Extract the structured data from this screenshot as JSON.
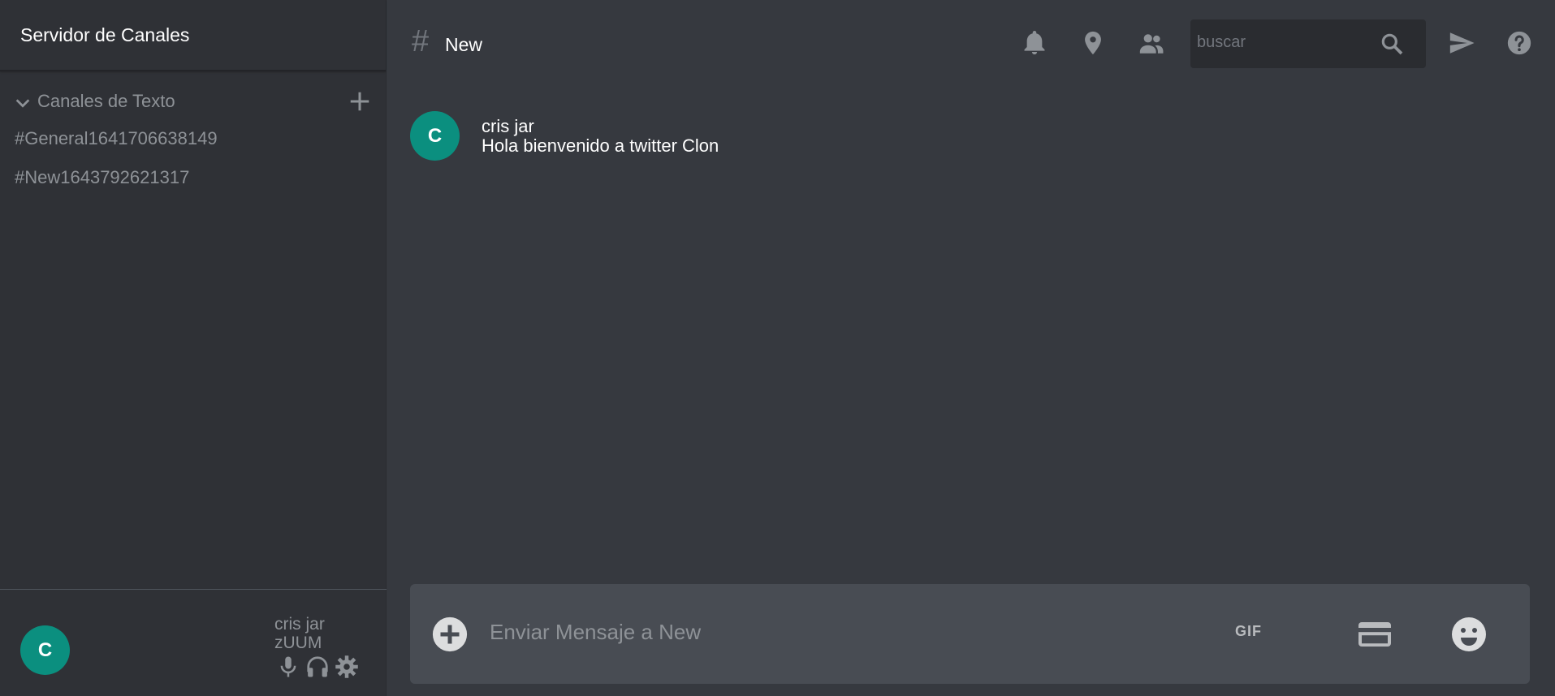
{
  "sidebar": {
    "server_title": "Servidor de Canales",
    "section_label": "Canales de Texto",
    "channels": [
      {
        "label": "#General1641706638149"
      },
      {
        "label": "#New1643792621317"
      }
    ],
    "user": {
      "avatar_letter": "C",
      "name": "cris jar",
      "tag": "zUUM"
    }
  },
  "header": {
    "hash_symbol": "#",
    "channel_name": "New",
    "search": {
      "placeholder": "buscar"
    }
  },
  "messages": [
    {
      "avatar_letter": "C",
      "author": "cris jar",
      "text": "Hola bienvenido a twitter Clon"
    }
  ],
  "composer": {
    "placeholder": "Enviar Mensaje a New",
    "gif_label": "GIF"
  },
  "colors": {
    "sidebar_bg": "#2f3136",
    "main_bg": "#36393f",
    "avatar_bg": "#0b8f7f",
    "icon_gray": "#8e9297",
    "composer_bg": "#484c53"
  },
  "icons": [
    "chevron-down-icon",
    "plus-icon",
    "mic-icon",
    "headphones-icon",
    "gear-icon",
    "bell-icon",
    "pin-icon",
    "people-icon",
    "search-icon",
    "send-icon",
    "help-icon",
    "add-circle-icon",
    "card-icon",
    "emoji-icon"
  ]
}
